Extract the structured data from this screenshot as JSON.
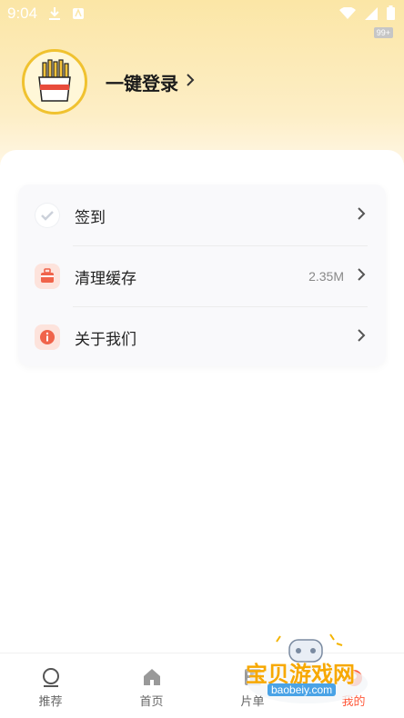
{
  "status_bar": {
    "time": "9:04",
    "badge": "99+"
  },
  "profile": {
    "login_label": "一键登录"
  },
  "menu": [
    {
      "label": "签到",
      "value": "",
      "icon": "check-circle-icon"
    },
    {
      "label": "清理缓存",
      "value": "2.35M",
      "icon": "trash-basket-icon"
    },
    {
      "label": "关于我们",
      "value": "",
      "icon": "info-icon"
    }
  ],
  "tabs": [
    {
      "label": "推荐",
      "icon": "circle-icon"
    },
    {
      "label": "首页",
      "icon": "home-icon"
    },
    {
      "label": "片单",
      "icon": "playlist-icon"
    },
    {
      "label": "我的",
      "icon": "profile-icon",
      "active": true
    }
  ],
  "watermark": {
    "text": "宝贝游戏网",
    "url": "baobeiy.com"
  },
  "colors": {
    "accent": "#ff5a3c",
    "header_bg": "#fbe6a6",
    "avatar_border": "#f0c230"
  }
}
